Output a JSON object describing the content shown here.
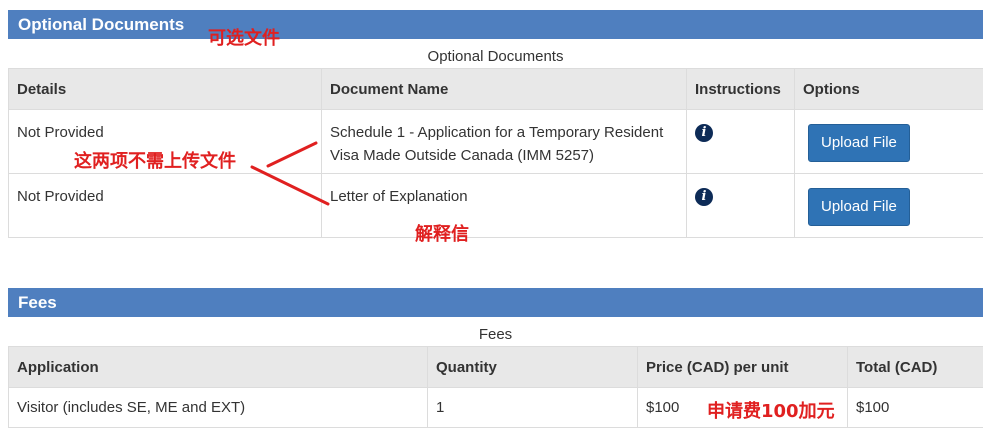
{
  "optional_documents": {
    "panel_title": "Optional Documents",
    "table_caption": "Optional Documents",
    "columns": [
      "Details",
      "Document Name",
      "Instructions",
      "Options"
    ],
    "rows": [
      {
        "details": "Not Provided",
        "document_name": "Schedule 1 - Application for a Temporary Resident Visa Made Outside Canada (IMM 5257)",
        "instructions_icon": "info-icon",
        "upload_label": "Upload File"
      },
      {
        "details": "Not Provided",
        "document_name": "Letter of Explanation",
        "instructions_icon": "info-icon",
        "upload_label": "Upload File"
      }
    ]
  },
  "fees": {
    "panel_title": "Fees",
    "table_caption": "Fees",
    "columns": [
      "Application",
      "Quantity",
      "Price (CAD) per unit",
      "Total (CAD)"
    ],
    "rows": [
      {
        "application": "Visitor (includes SE, ME and EXT)",
        "quantity": "1",
        "price": "$100",
        "total": "$100"
      }
    ]
  },
  "annotations": {
    "optional_files": "可选文件",
    "no_upload_needed": "这两项不需上传文件",
    "explanation_letter": "解释信",
    "fee_note": "申请费100加元"
  },
  "colors": {
    "panel_header": "#4f7fbf",
    "button": "#2f73b5",
    "annotation": "#e02020",
    "info_icon": "#0d2b57"
  }
}
